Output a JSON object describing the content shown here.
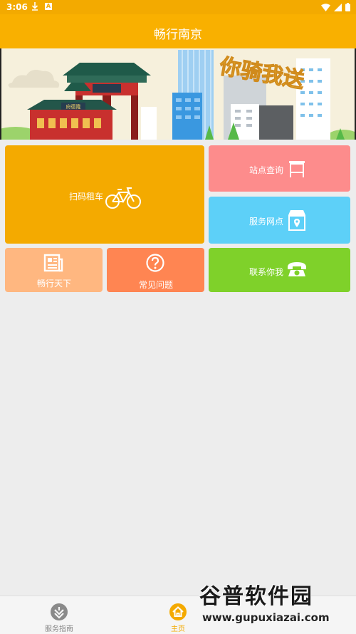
{
  "status_bar": {
    "time": "3:06"
  },
  "app_bar": {
    "title": "畅行南京"
  },
  "banner": {
    "slogan": "你骑我送",
    "gate_sign": "府德隆"
  },
  "tiles": {
    "rent": "扫码租车",
    "station": "站点查询",
    "service": "服务网点",
    "news": "畅行天下",
    "faq": "常见问题",
    "contact": "联系你我"
  },
  "bottom_nav": {
    "guide": "服务指南",
    "home": "主页"
  },
  "watermark": {
    "title": "谷普软件园",
    "url": "www.gupuxiazai.com"
  },
  "colors": {
    "primary": "#f9b000",
    "rent": "#f4aa00",
    "station": "#fd8c8c",
    "service": "#5dd0f8",
    "news": "#ffb780",
    "faq": "#ff8552",
    "contact": "#7fd12a"
  }
}
